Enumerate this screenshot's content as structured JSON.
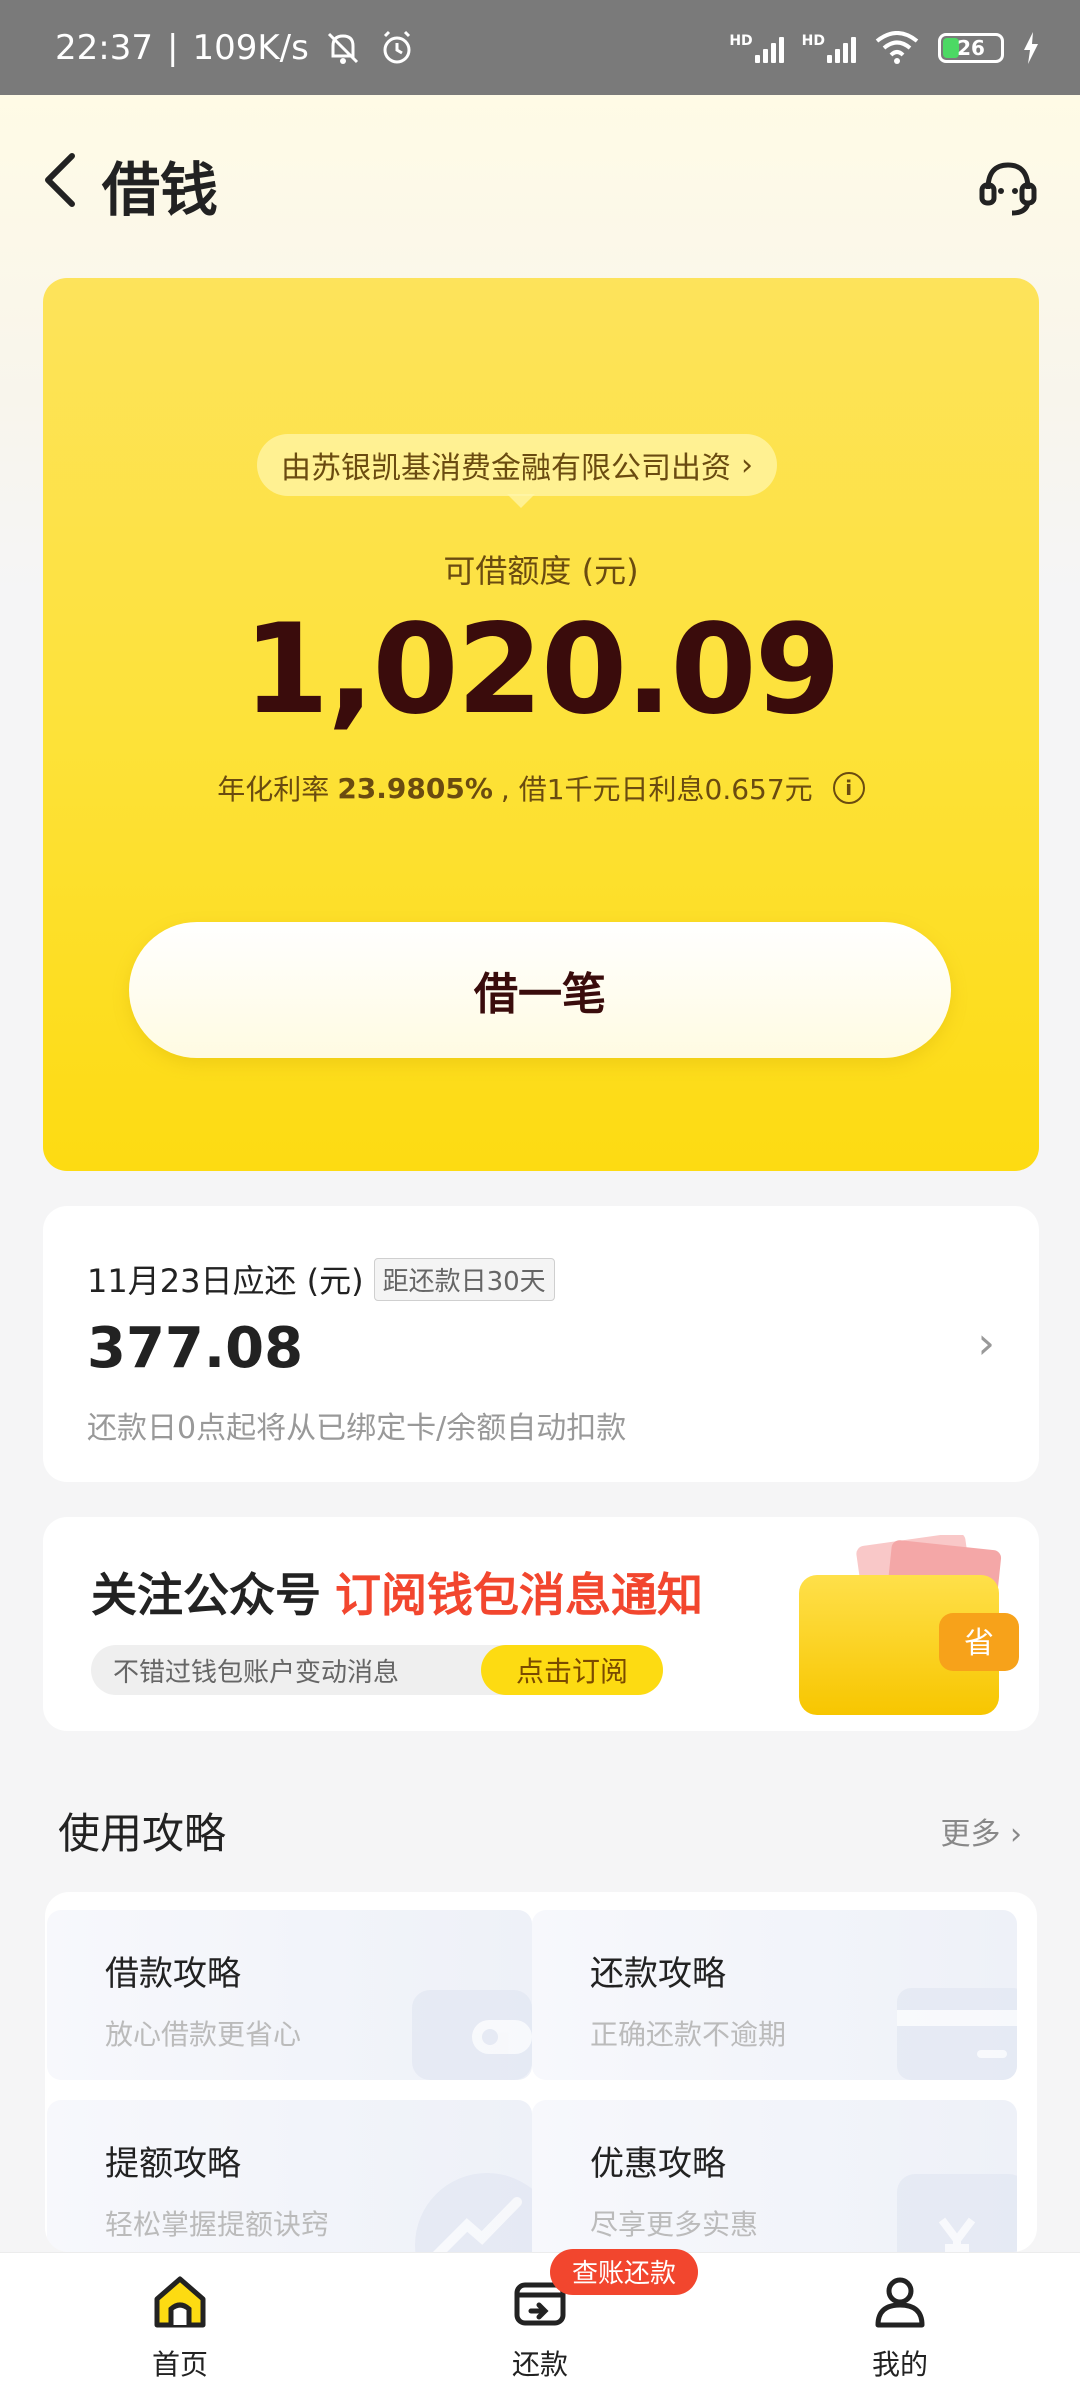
{
  "status_bar": {
    "time": "22:37",
    "speed": "109K/s",
    "battery": "26"
  },
  "nav": {
    "title": "借钱"
  },
  "loan_card": {
    "funder": "由苏银凯基消费金融有限公司出资",
    "limit_label": "可借额度 (元)",
    "limit_value": "1,020.09",
    "rate_prefix": "年化利率",
    "rate_value": "23.9805%",
    "rate_suffix": ", 借1千元日利息0.657元",
    "borrow_button": "借一笔"
  },
  "repayment": {
    "due_label": "11月23日应还 (元)",
    "days_tag": "距还款日30天",
    "amount": "377.08",
    "note": "还款日0点起将从已绑定卡/余额自动扣款"
  },
  "follow_banner": {
    "title_prefix": "关注公众号",
    "title_highlight": "订阅钱包消息通知",
    "pill_text": "不错过钱包账户变动消息",
    "subscribe_button": "点击订阅",
    "wallet_badge": "省"
  },
  "guides": {
    "title": "使用攻略",
    "more": "更多",
    "items": [
      {
        "title": "借款攻略",
        "subtitle": "放心借款更省心"
      },
      {
        "title": "还款攻略",
        "subtitle": "正确还款不逾期"
      },
      {
        "title": "提额攻略",
        "subtitle": "轻松掌握提额诀窍"
      },
      {
        "title": "优惠攻略",
        "subtitle": "尽享更多实惠"
      }
    ]
  },
  "tabbar": {
    "tabs": [
      {
        "label": "首页"
      },
      {
        "label": "还款"
      },
      {
        "label": "我的"
      }
    ],
    "repay_badge": "查账还款"
  },
  "colors": {
    "accent_yellow": "#fddb12",
    "highlight_red": "#f2462e",
    "amount_dark": "#3a0c0c"
  }
}
